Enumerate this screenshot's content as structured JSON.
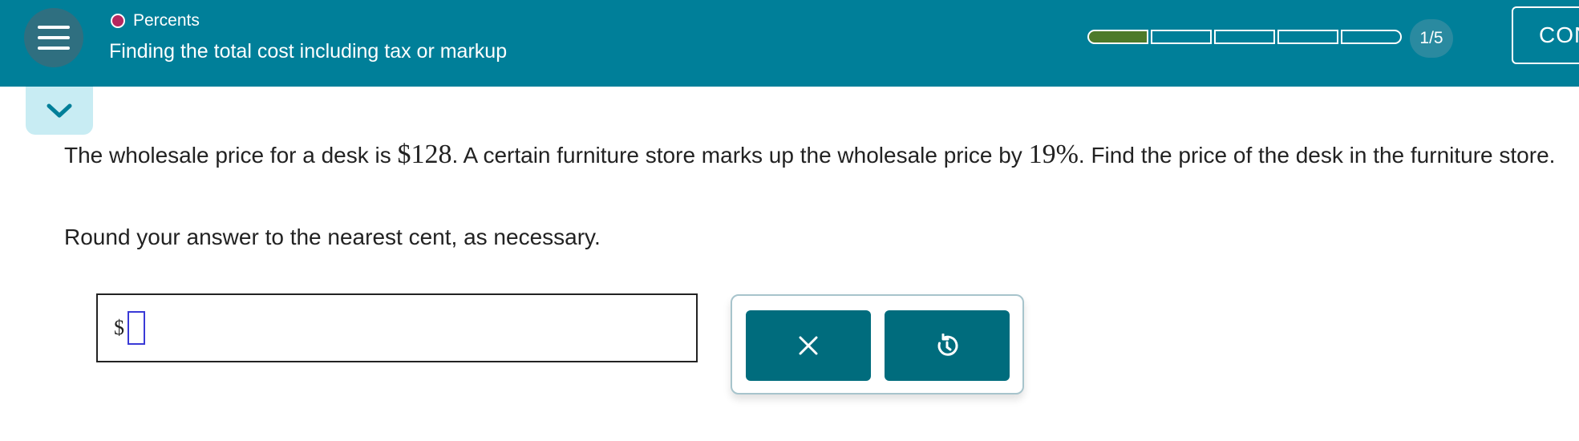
{
  "header": {
    "topic": "Percents",
    "subtitle": "Finding the total cost including tax or markup",
    "progress": {
      "current": 1,
      "total": 5,
      "label": "1/5"
    },
    "continue_label": "CONTINUE",
    "accent_color": "#007f99",
    "topic_dot_color": "#b5275f",
    "progress_fill_color": "#4d7a2a"
  },
  "icons": {
    "menu": "hamburger-menu-icon",
    "collapse": "chevron-down-icon",
    "clear": "close-icon",
    "undo": "undo-icon"
  },
  "question": {
    "part1": "The wholesale price for a desk is ",
    "price": "$128",
    "part2": ". A certain furniture store marks up the wholesale price by ",
    "percent": "19%",
    "part3": ". Find the price of the desk in the furniture store.",
    "instruction": "Round your answer to the nearest cent, as necessary."
  },
  "answer": {
    "currency_symbol": "$",
    "value": ""
  }
}
